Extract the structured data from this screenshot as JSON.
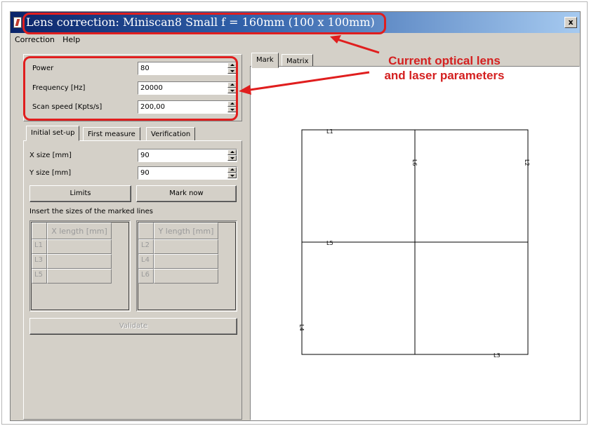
{
  "window": {
    "title": "Lens correction: Miniscan8 Small f = 160mm (100 x 100mm)",
    "close_symbol": "x"
  },
  "menu": [
    "Correction",
    "Help"
  ],
  "parameters": [
    {
      "label": "Power",
      "value": "80"
    },
    {
      "label": "Frequency [Hz]",
      "value": "20000"
    },
    {
      "label": "Scan speed [Kpts/s]",
      "value": "200,00"
    }
  ],
  "left_tabs": [
    "Initial set-up",
    "First measure",
    "Verification"
  ],
  "setup": {
    "x_size_label": "X size [mm]",
    "x_size_value": "90",
    "y_size_label": "Y size [mm]",
    "y_size_value": "90",
    "limits_button": "Limits",
    "mark_now_button": "Mark now",
    "insert_label": "Insert the sizes of the marked lines",
    "x_table": {
      "header": "X length [mm]",
      "rows": [
        "L1",
        "L3",
        "L5"
      ]
    },
    "y_table": {
      "header": "Y length [mm]",
      "rows": [
        "L2",
        "L4",
        "L6"
      ]
    },
    "validate_button": "Validate"
  },
  "right_tabs": [
    "Mark",
    "Matrix"
  ],
  "drawing_labels": {
    "L1": "L1",
    "L2": "L2",
    "L3": "L3",
    "L4": "L4",
    "L5": "L5",
    "L6": "L6"
  },
  "annotation": {
    "line1": "Current optical lens",
    "line2": "and laser parameters",
    "color": "#e01e1e"
  }
}
